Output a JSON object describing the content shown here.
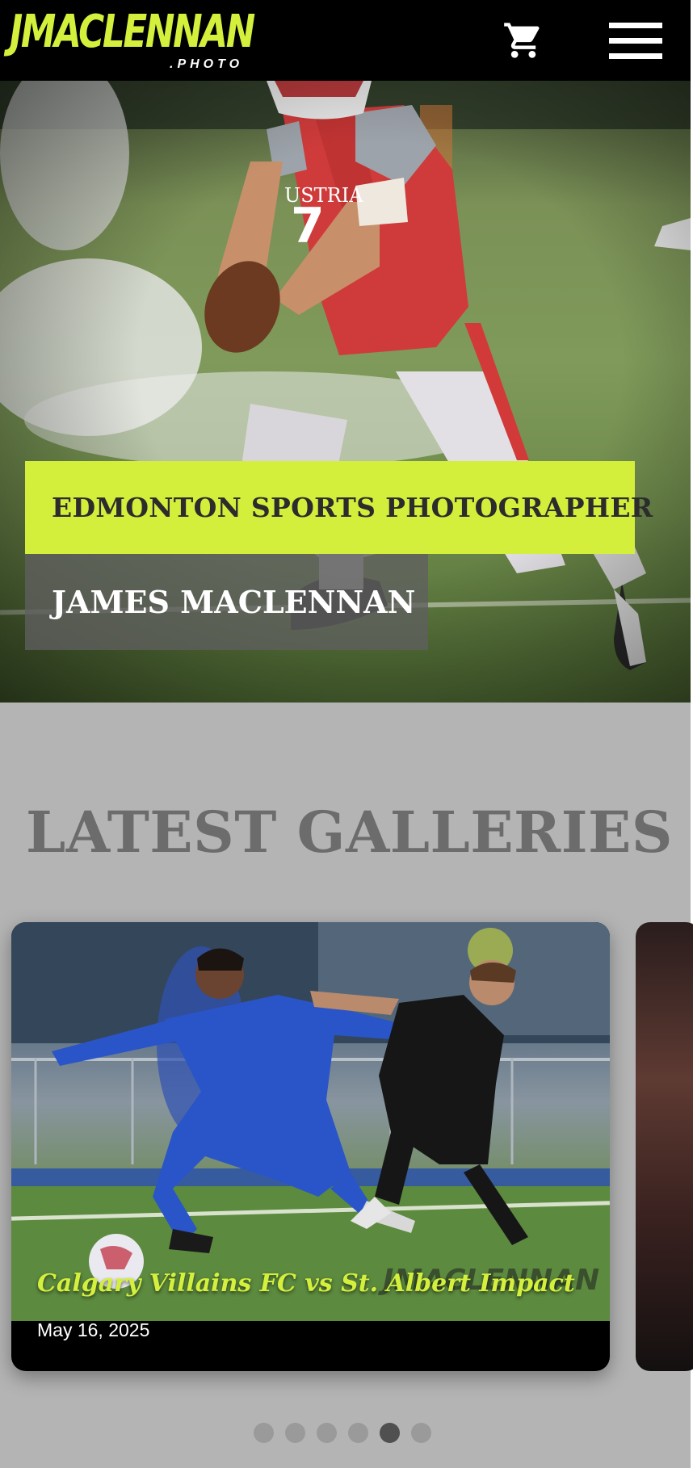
{
  "header": {
    "logo_main": "JMACLENNAN",
    "logo_sub": ".PHOTO",
    "cart_icon": "shopping-cart-icon",
    "menu_icon": "hamburger-menu-icon",
    "brand_color": "#d4f03d"
  },
  "hero": {
    "headline": "EDMONTON SPORTS PHOTOGRAPHER",
    "name": "JAMES MACLENNAN",
    "accent_color": "#d4ee3c"
  },
  "galleries": {
    "title": "LATEST GALLERIES",
    "cards": [
      {
        "title": "Calgary Villains FC vs St. Albert Impact",
        "date": "May 16, 2025",
        "watermark": "JMACLENNAN"
      }
    ],
    "carousel": {
      "dot_count": 6,
      "active_index": 4
    }
  }
}
